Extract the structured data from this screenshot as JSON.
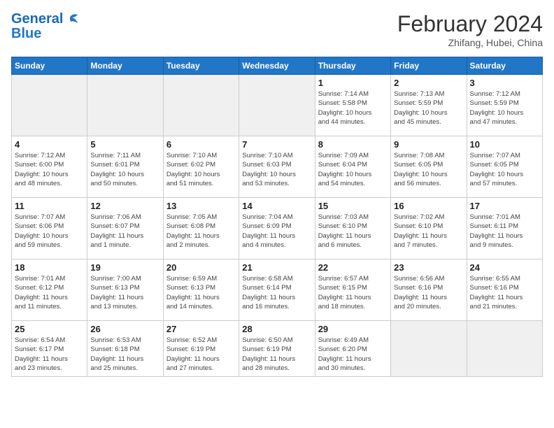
{
  "header": {
    "logo_general": "General",
    "logo_blue": "Blue",
    "month_year": "February 2024",
    "location": "Zhifang, Hubei, China"
  },
  "days_of_week": [
    "Sunday",
    "Monday",
    "Tuesday",
    "Wednesday",
    "Thursday",
    "Friday",
    "Saturday"
  ],
  "weeks": [
    [
      {
        "day": "",
        "info": ""
      },
      {
        "day": "",
        "info": ""
      },
      {
        "day": "",
        "info": ""
      },
      {
        "day": "",
        "info": ""
      },
      {
        "day": "1",
        "info": "Sunrise: 7:14 AM\nSunset: 5:58 PM\nDaylight: 10 hours\nand 44 minutes."
      },
      {
        "day": "2",
        "info": "Sunrise: 7:13 AM\nSunset: 5:59 PM\nDaylight: 10 hours\nand 45 minutes."
      },
      {
        "day": "3",
        "info": "Sunrise: 7:12 AM\nSunset: 5:59 PM\nDaylight: 10 hours\nand 47 minutes."
      }
    ],
    [
      {
        "day": "4",
        "info": "Sunrise: 7:12 AM\nSunset: 6:00 PM\nDaylight: 10 hours\nand 48 minutes."
      },
      {
        "day": "5",
        "info": "Sunrise: 7:11 AM\nSunset: 6:01 PM\nDaylight: 10 hours\nand 50 minutes."
      },
      {
        "day": "6",
        "info": "Sunrise: 7:10 AM\nSunset: 6:02 PM\nDaylight: 10 hours\nand 51 minutes."
      },
      {
        "day": "7",
        "info": "Sunrise: 7:10 AM\nSunset: 6:03 PM\nDaylight: 10 hours\nand 53 minutes."
      },
      {
        "day": "8",
        "info": "Sunrise: 7:09 AM\nSunset: 6:04 PM\nDaylight: 10 hours\nand 54 minutes."
      },
      {
        "day": "9",
        "info": "Sunrise: 7:08 AM\nSunset: 6:05 PM\nDaylight: 10 hours\nand 56 minutes."
      },
      {
        "day": "10",
        "info": "Sunrise: 7:07 AM\nSunset: 6:05 PM\nDaylight: 10 hours\nand 57 minutes."
      }
    ],
    [
      {
        "day": "11",
        "info": "Sunrise: 7:07 AM\nSunset: 6:06 PM\nDaylight: 10 hours\nand 59 minutes."
      },
      {
        "day": "12",
        "info": "Sunrise: 7:06 AM\nSunset: 6:07 PM\nDaylight: 11 hours\nand 1 minute."
      },
      {
        "day": "13",
        "info": "Sunrise: 7:05 AM\nSunset: 6:08 PM\nDaylight: 11 hours\nand 2 minutes."
      },
      {
        "day": "14",
        "info": "Sunrise: 7:04 AM\nSunset: 6:09 PM\nDaylight: 11 hours\nand 4 minutes."
      },
      {
        "day": "15",
        "info": "Sunrise: 7:03 AM\nSunset: 6:10 PM\nDaylight: 11 hours\nand 6 minutes."
      },
      {
        "day": "16",
        "info": "Sunrise: 7:02 AM\nSunset: 6:10 PM\nDaylight: 11 hours\nand 7 minutes."
      },
      {
        "day": "17",
        "info": "Sunrise: 7:01 AM\nSunset: 6:11 PM\nDaylight: 11 hours\nand 9 minutes."
      }
    ],
    [
      {
        "day": "18",
        "info": "Sunrise: 7:01 AM\nSunset: 6:12 PM\nDaylight: 11 hours\nand 11 minutes."
      },
      {
        "day": "19",
        "info": "Sunrise: 7:00 AM\nSunset: 6:13 PM\nDaylight: 11 hours\nand 13 minutes."
      },
      {
        "day": "20",
        "info": "Sunrise: 6:59 AM\nSunset: 6:13 PM\nDaylight: 11 hours\nand 14 minutes."
      },
      {
        "day": "21",
        "info": "Sunrise: 6:58 AM\nSunset: 6:14 PM\nDaylight: 11 hours\nand 16 minutes."
      },
      {
        "day": "22",
        "info": "Sunrise: 6:57 AM\nSunset: 6:15 PM\nDaylight: 11 hours\nand 18 minutes."
      },
      {
        "day": "23",
        "info": "Sunrise: 6:56 AM\nSunset: 6:16 PM\nDaylight: 11 hours\nand 20 minutes."
      },
      {
        "day": "24",
        "info": "Sunrise: 6:55 AM\nSunset: 6:16 PM\nDaylight: 11 hours\nand 21 minutes."
      }
    ],
    [
      {
        "day": "25",
        "info": "Sunrise: 6:54 AM\nSunset: 6:17 PM\nDaylight: 11 hours\nand 23 minutes."
      },
      {
        "day": "26",
        "info": "Sunrise: 6:53 AM\nSunset: 6:18 PM\nDaylight: 11 hours\nand 25 minutes."
      },
      {
        "day": "27",
        "info": "Sunrise: 6:52 AM\nSunset: 6:19 PM\nDaylight: 11 hours\nand 27 minutes."
      },
      {
        "day": "28",
        "info": "Sunrise: 6:50 AM\nSunset: 6:19 PM\nDaylight: 11 hours\nand 28 minutes."
      },
      {
        "day": "29",
        "info": "Sunrise: 6:49 AM\nSunset: 6:20 PM\nDaylight: 11 hours\nand 30 minutes."
      },
      {
        "day": "",
        "info": ""
      },
      {
        "day": "",
        "info": ""
      }
    ]
  ]
}
